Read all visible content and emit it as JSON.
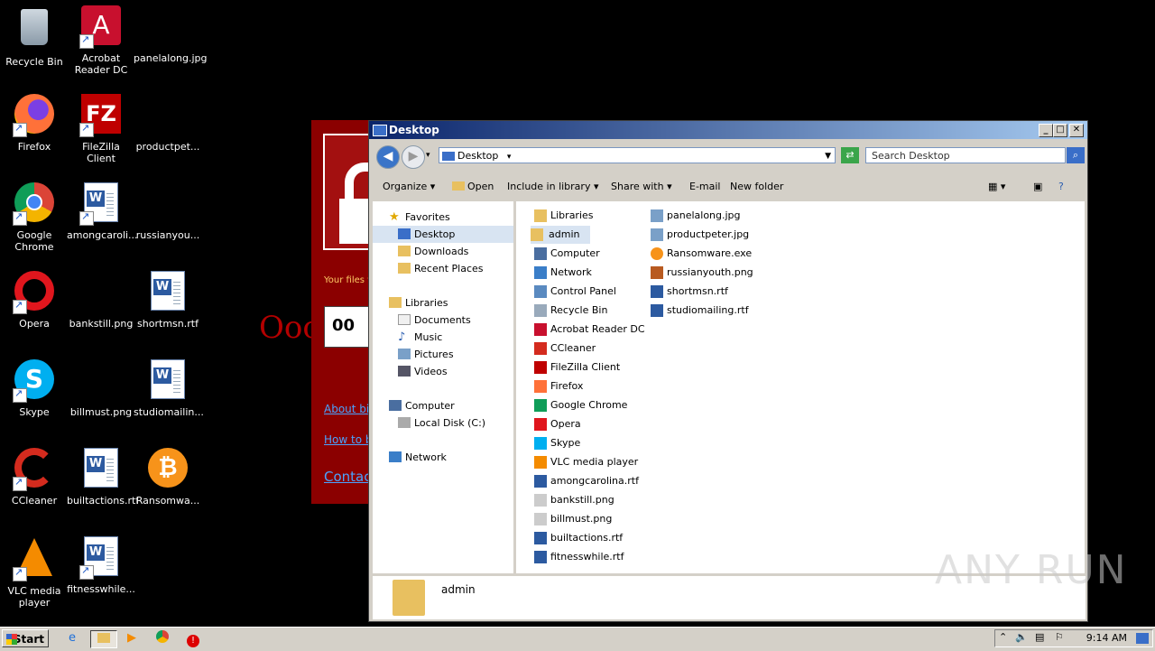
{
  "desktop_icons": [
    {
      "label": "Recycle Bin"
    },
    {
      "label": "Acrobat Reader DC"
    },
    {
      "label": "panelalong.jpg"
    },
    {
      "label": "Firefox"
    },
    {
      "label": "FileZilla Client"
    },
    {
      "label": "productpet..."
    },
    {
      "label": "Google Chrome"
    },
    {
      "label": "amongcaroli..."
    },
    {
      "label": "russianyou..."
    },
    {
      "label": "Opera"
    },
    {
      "label": "bankstill.png"
    },
    {
      "label": "shortmsn.rtf"
    },
    {
      "label": "Skype"
    },
    {
      "label": "billmust.png"
    },
    {
      "label": "studiomailin..."
    },
    {
      "label": "CCleaner"
    },
    {
      "label": "builtactions.rtf"
    },
    {
      "label": "Ransomwa..."
    },
    {
      "label": "VLC media player"
    },
    {
      "label": "fitnesswhile..."
    }
  ],
  "ransom_window": {
    "your_files": "Your files w",
    "timer": "00",
    "link1": "About bit",
    "link2": "How to b",
    "link3": "Contac",
    "big_text": "Ooo"
  },
  "explorer": {
    "title": "Desktop",
    "address": "Desktop",
    "search_placeholder": "Search Desktop",
    "toolbar": {
      "organize": "Organize",
      "open": "Open",
      "include": "Include in library",
      "share": "Share with",
      "email": "E-mail",
      "new_folder": "New folder"
    },
    "nav": {
      "favorites": "Favorites",
      "desktop": "Desktop",
      "downloads": "Downloads",
      "recent": "Recent Places",
      "libraries": "Libraries",
      "documents": "Documents",
      "music": "Music",
      "pictures": "Pictures",
      "videos": "Videos",
      "computer": "Computer",
      "local_disk": "Local Disk (C:)",
      "network": "Network"
    },
    "files_col1": [
      "Libraries",
      "admin",
      "Computer",
      "Network",
      "Control Panel",
      "Recycle Bin",
      "Acrobat Reader DC",
      "CCleaner",
      "FileZilla Client",
      "Firefox",
      "Google Chrome",
      "Opera",
      "Skype",
      "VLC media player",
      "amongcarolina.rtf",
      "bankstill.png",
      "billmust.png",
      "builtactions.rtf",
      "fitnesswhile.rtf"
    ],
    "files_col2": [
      "panelalong.jpg",
      "productpeter.jpg",
      "Ransomware.exe",
      "russianyouth.png",
      "shortmsn.rtf",
      "studiomailing.rtf"
    ],
    "details_name": "admin"
  },
  "taskbar": {
    "start": "Start",
    "clock": "9:14 AM"
  },
  "watermark": "ANY RUN"
}
